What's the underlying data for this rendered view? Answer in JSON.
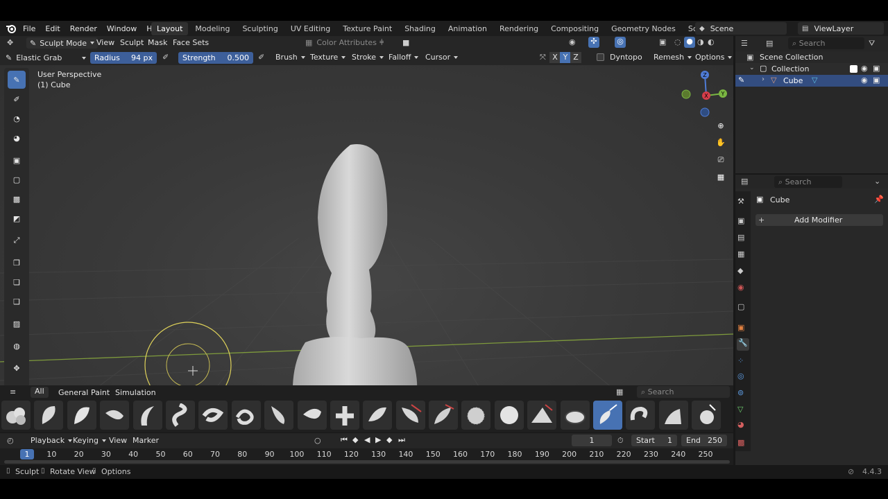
{
  "menu": [
    "File",
    "Edit",
    "Render",
    "Window",
    "Help"
  ],
  "workspaces": [
    "Layout",
    "Modeling",
    "Sculpting",
    "UV Editing",
    "Texture Paint",
    "Shading",
    "Animation",
    "Rendering",
    "Compositing",
    "Geometry Nodes",
    "Scripting"
  ],
  "active_workspace": "Layout",
  "scene": {
    "label": "Scene",
    "viewlayer": "ViewLayer"
  },
  "header": {
    "mode": "Sculpt Mode",
    "menus": [
      "View",
      "Sculpt",
      "Mask",
      "Face Sets"
    ],
    "color_attributes": "Color Attributes"
  },
  "tool": {
    "brush_name": "Elastic Grab",
    "radius_label": "Radius",
    "radius_value": "94 px",
    "strength_label": "Strength",
    "strength_value": "0.500",
    "menus": [
      "Brush",
      "Texture",
      "Stroke",
      "Falloff",
      "Cursor"
    ],
    "axes": [
      "X",
      "Y",
      "Z"
    ],
    "dyntopo": "Dyntopo",
    "remesh": "Remesh",
    "options": "Options"
  },
  "viewport": {
    "perspective": "User Perspective",
    "object": "(1) Cube"
  },
  "outliner": {
    "search_placeholder": "Search",
    "scene_collection": "Scene Collection",
    "collection": "Collection",
    "cube": "Cube"
  },
  "properties": {
    "search_placeholder": "Search",
    "object": "Cube",
    "add_modifier": "Add Modifier"
  },
  "asset_shelf": {
    "tabs": [
      "All",
      "General",
      "Paint",
      "Simulation"
    ],
    "search_placeholder": "Search"
  },
  "timeline": {
    "menus": [
      "Playback",
      "Keying",
      "View",
      "Marker"
    ],
    "current_frame": "1",
    "start_label": "Start",
    "start": "1",
    "end_label": "End",
    "end": "250",
    "ticks": [
      "1",
      "10",
      "20",
      "30",
      "40",
      "50",
      "60",
      "70",
      "80",
      "90",
      "100",
      "110",
      "120",
      "130",
      "140",
      "150",
      "160",
      "170",
      "180",
      "190",
      "200",
      "210",
      "220",
      "230",
      "240",
      "250"
    ]
  },
  "status": {
    "items": [
      "Sculpt",
      "Rotate View",
      "Options"
    ],
    "version": "4.4.3"
  },
  "colors": {
    "accent": "#4772b3",
    "header": "#262626",
    "viewport": "#3d3d3d"
  }
}
